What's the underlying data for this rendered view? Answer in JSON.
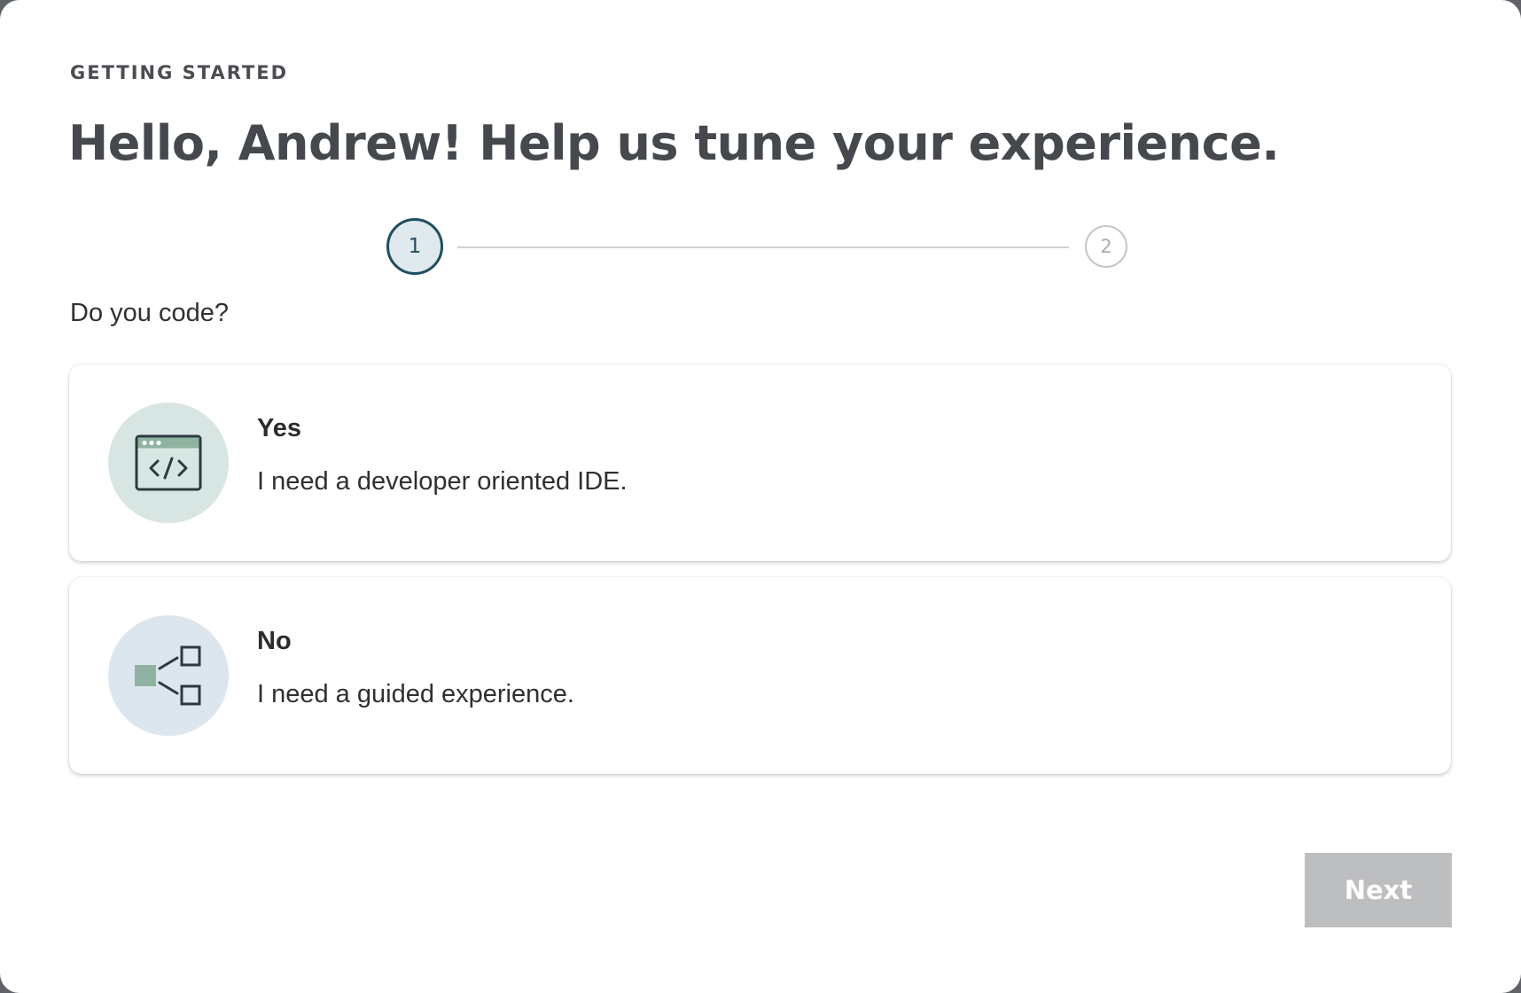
{
  "header": {
    "eyebrow": "GETTING STARTED",
    "title": "Hello, Andrew! Help us tune your experience."
  },
  "stepper": {
    "steps": [
      {
        "label": "1",
        "state": "active"
      },
      {
        "label": "2",
        "state": "inactive"
      }
    ]
  },
  "question": "Do you code?",
  "options": [
    {
      "icon": "code-window-icon",
      "label": "Yes",
      "description": "I need a developer oriented IDE."
    },
    {
      "icon": "guided-flow-icon",
      "label": "No",
      "description": "I need a guided experience."
    }
  ],
  "footer": {
    "next_label": "Next",
    "next_enabled": false
  },
  "colors": {
    "step_active": "#1f4e5f",
    "icon_green": "#8fb3a0",
    "button_disabled": "#bdbec0"
  }
}
